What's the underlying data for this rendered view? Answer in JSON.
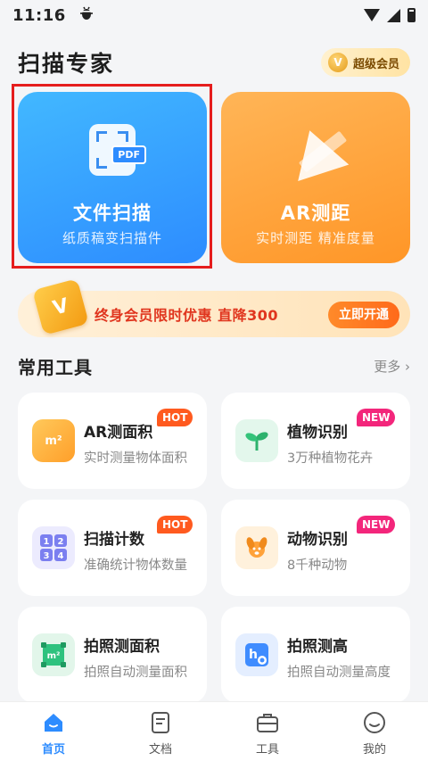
{
  "status_bar": {
    "time": "11:16",
    "notification_icon": "bug-icon"
  },
  "header": {
    "title": "扫描专家",
    "vip_label": "超级会员",
    "vip_icon_letter": "V"
  },
  "hero": [
    {
      "title": "文件扫描",
      "subtitle": "纸质稿变扫描件",
      "icon": "scan-document-icon",
      "icon_tag": "PDF",
      "color": "#2d8cff"
    },
    {
      "title": "AR测距",
      "subtitle": "实时测距 精准度量",
      "icon": "ruler-triangle-icon",
      "color": "#ff9a2f"
    }
  ],
  "promo": {
    "icon_letter": "V",
    "text": "终身会员限时优惠 直降300",
    "button": "立即开通"
  },
  "section": {
    "title": "常用工具",
    "more": "更多 ›"
  },
  "tools": [
    {
      "name": "AR测面积",
      "desc": "实时测量物体面积",
      "tag": "HOT",
      "icon": "area-cube-icon",
      "icon_text": "m²",
      "color": "#ffb13d"
    },
    {
      "name": "植物识别",
      "desc": "3万种植物花卉",
      "tag": "NEW",
      "icon": "plant-sprout-icon",
      "icon_text": "",
      "color": "#34c37a"
    },
    {
      "name": "扫描计数",
      "desc": "准确统计物体数量",
      "tag": "HOT",
      "icon": "number-grid-icon",
      "icon_text": "1 2\n3 4",
      "color": "#7b7ff0"
    },
    {
      "name": "动物识别",
      "desc": "8千种动物",
      "tag": "NEW",
      "icon": "dog-icon",
      "icon_text": "",
      "color": "#ffa23a"
    },
    {
      "name": "拍照测面积",
      "desc": "拍照自动测量面积",
      "tag": "",
      "icon": "photo-area-icon",
      "icon_text": "m²",
      "color": "#2ec27e"
    },
    {
      "name": "拍照测高",
      "desc": "拍照自动测量高度",
      "tag": "",
      "icon": "photo-height-icon",
      "icon_text": "h",
      "color": "#3f8cff"
    }
  ],
  "nav": [
    {
      "label": "首页",
      "icon": "home-icon",
      "active": true
    },
    {
      "label": "文档",
      "icon": "document-icon",
      "active": false
    },
    {
      "label": "工具",
      "icon": "toolbox-icon",
      "active": false
    },
    {
      "label": "我的",
      "icon": "profile-smile-icon",
      "active": false
    }
  ]
}
